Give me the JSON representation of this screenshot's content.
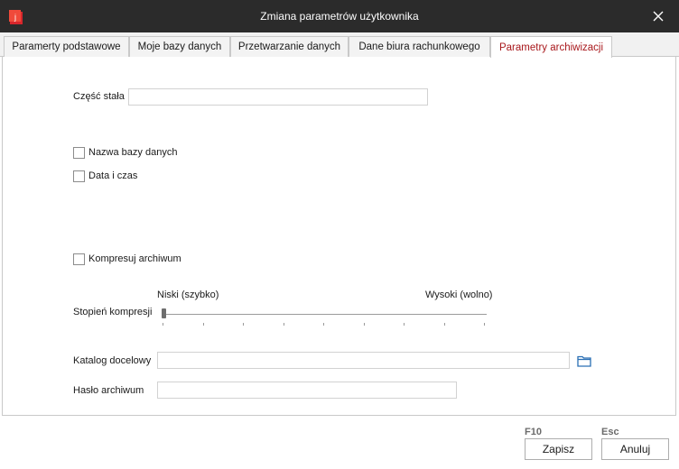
{
  "window": {
    "title": "Zmiana parametrów użytkownika",
    "icon": "app-logo-icon",
    "close_icon": "close-icon"
  },
  "tabs": [
    {
      "label": "Paramerty podstawowe",
      "active": false
    },
    {
      "label": "Moje bazy danych",
      "active": false
    },
    {
      "label": "Przetwarzanie danych",
      "active": false
    },
    {
      "label": "Dane biura rachunkowego",
      "active": false
    },
    {
      "label": "Parametry archiwizacji",
      "active": true
    }
  ],
  "form": {
    "fixed_part_label": "Część stała",
    "fixed_part_value": "",
    "db_name_label": "Nazwa bazy danych",
    "db_name_checked": false,
    "datetime_label": "Data i czas",
    "datetime_checked": false,
    "compress_label": "Kompresuj archiwum",
    "compress_checked": false,
    "compression_level_label": "Stopień kompresji",
    "slider_min_label": "Niski (szybko)",
    "slider_max_label": "Wysoki (wolno)",
    "slider_value": 0,
    "target_dir_label": "Katalog docelowy",
    "target_dir_value": "",
    "browse_icon": "folder-icon",
    "password_label": "Hasło archiwum",
    "password_value": ""
  },
  "footer": {
    "save_hotkey": "F10",
    "save_label": "Zapisz",
    "cancel_hotkey": "Esc",
    "cancel_label": "Anuluj"
  },
  "colors": {
    "titlebar": "#2b2b2b",
    "active_tab_text": "#a8181c",
    "accent_icon": "#d8262c",
    "folder_icon": "#2a6fb4"
  }
}
